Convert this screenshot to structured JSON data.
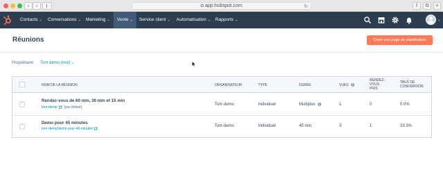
{
  "browser": {
    "url": "app.hubspot.com",
    "nav_back_glyph": "‹",
    "nav_forward_glyph": "›",
    "reload_glyph": "↻",
    "share_glyph": "⇪",
    "tabs_glyph": "⧉",
    "add_tab_glyph": "+"
  },
  "navbar": {
    "background": "#2d3e50",
    "items": [
      {
        "label": "Contacts"
      },
      {
        "label": "Conversations"
      },
      {
        "label": "Marketing"
      },
      {
        "label": "Vente"
      },
      {
        "label": "Service client"
      },
      {
        "label": "Automatisation"
      },
      {
        "label": "Rapports"
      }
    ],
    "active_item": "Vente",
    "caret": "⌄",
    "icons": [
      "search-icon",
      "marketplace-icon",
      "settings-icon",
      "notifications-icon",
      "avatar"
    ]
  },
  "page": {
    "title": "Réunions",
    "cta_label": "Créer une page de planification",
    "accent": "#ff7a59"
  },
  "filter": {
    "owner_label": "Propriétaire:",
    "owner_value": "Tom demo (moi)",
    "caret": "⌄"
  },
  "table": {
    "columns": {
      "name": "NOM DE LA RÉUNION",
      "organizer": "ORGANISATEUR",
      "type": "TYPE",
      "duration": "DURÉE",
      "views": "VUES",
      "booked_l1": "RENDEZ-",
      "booked_l2": "VOUS",
      "booked_l3": "PRIS",
      "conversion_l1": "TAUX DE",
      "conversion_l2": "CONVERSION"
    },
    "info_glyph": "i",
    "rows": [
      {
        "name": "Rendez-vous de 60 min, 30 min et 15 min",
        "link": "tom-demp",
        "tag": "(par défaut)",
        "organizer": "Tom demo",
        "type": "Individuel",
        "duration": "Multiples",
        "views": "1",
        "booked": "0",
        "conversion": "0.0%"
      },
      {
        "name": "Demo pour 45 minutes",
        "link": "tom-demp/demo-pour-45-minutes",
        "tag": "",
        "organizer": "Tom demo",
        "type": "Individuel",
        "duration": "45 min",
        "views": "3",
        "booked": "1",
        "conversion": "33.3%"
      }
    ]
  }
}
